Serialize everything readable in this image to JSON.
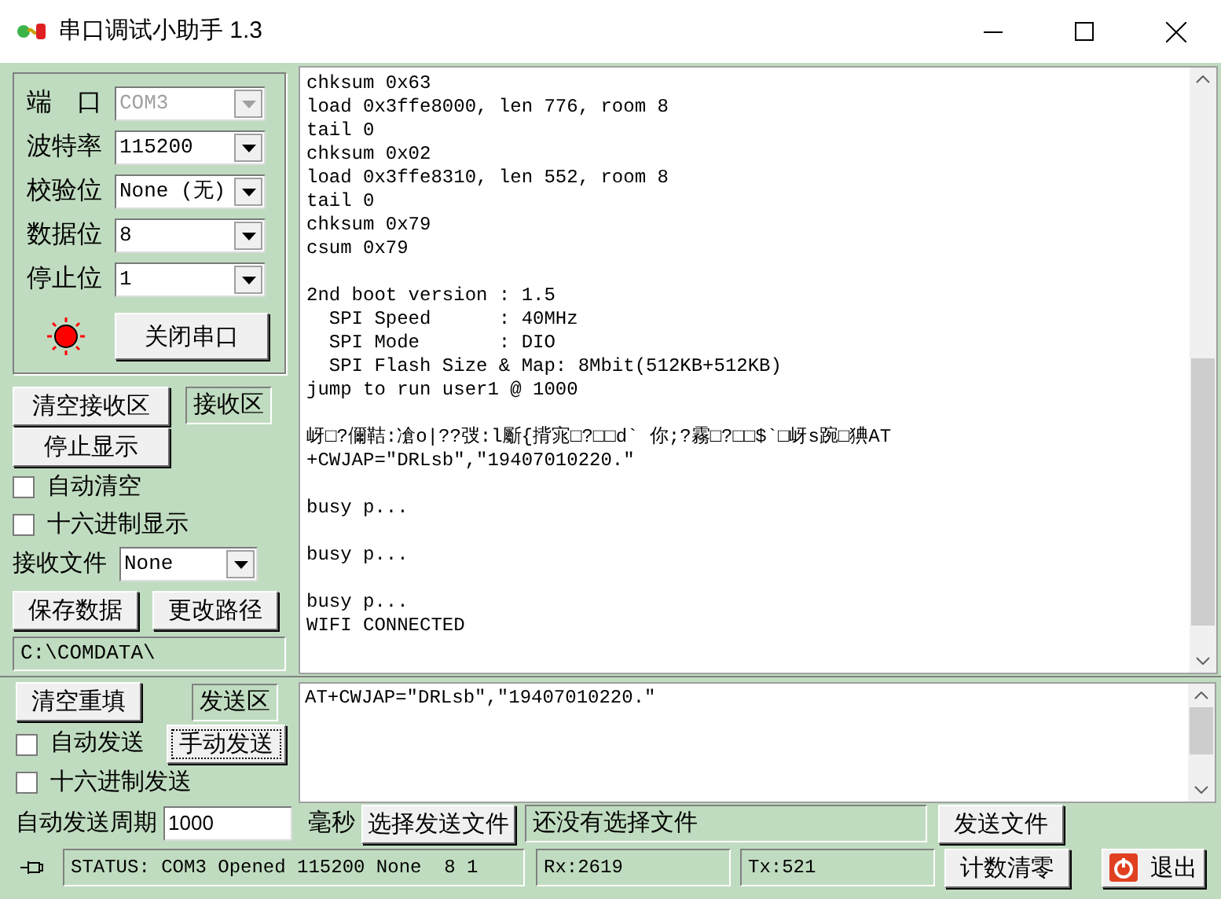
{
  "window": {
    "title": "串口调试小助手 1.3"
  },
  "serial_settings": [
    {
      "label": "端　口",
      "value": "COM3",
      "disabled": true
    },
    {
      "label": "波特率",
      "value": "115200",
      "disabled": false
    },
    {
      "label": "校验位",
      "value": "None (无)",
      "disabled": false
    },
    {
      "label": "数据位",
      "value": "8",
      "disabled": false
    },
    {
      "label": "停止位",
      "value": "1",
      "disabled": false
    }
  ],
  "port_led": {
    "on": true
  },
  "open_button": "关闭串口",
  "receive": {
    "clear_button": "清空接收区",
    "area_label": "接收区",
    "stop_button": "停止显示",
    "checkboxes": [
      {
        "label": "自动清空",
        "checked": false
      },
      {
        "label": "十六进制显示",
        "checked": false
      }
    ],
    "file_label": "接收文件",
    "file_value": "None",
    "save_button": "保存数据",
    "path_button": "更改路径",
    "path": "C:\\COMDATA\\",
    "blocks": [
      [
        "chksum 0x63",
        "load 0x3ffe8000, len 776, room 8",
        "tail 0",
        "chksum 0x02",
        "load 0x3ffe8310, len 552, room 8",
        "tail 0",
        "chksum 0x79",
        "csum 0x79"
      ],
      [
        "2nd boot version : 1.5",
        "  SPI Speed      : 40MHz",
        "  SPI Mode       : DIO",
        "  SPI Flash Size & Map: 8Mbit(512KB+512KB)",
        "jump to run user1 @ 1000"
      ],
      [
        "岈□?儞鞊:凔o|??弢:l斸{揹宨□?□□d` 你;?霧□?□□$`□岈s踠□猠AT",
        "+CWJAP=\"DRLsb\",\"19407010220.\""
      ],
      [
        "busy p..."
      ],
      [
        "busy p..."
      ],
      [
        "busy p...",
        "WIFI CONNECTED"
      ]
    ]
  },
  "send": {
    "clear_button": "清空重填",
    "area_label": "发送区",
    "manual_button": "手动发送",
    "checkboxes": [
      {
        "label": "自动发送",
        "checked": false
      },
      {
        "label": "十六进制发送",
        "checked": false
      }
    ],
    "text": "AT+CWJAP=\"DRLsb\",\"19407010220.\"",
    "period_label": "自动发送周期",
    "period": "1000",
    "unit": "毫秒",
    "choose_file_button": "选择发送文件",
    "file_status": "还没有选择文件",
    "send_file_button": "发送文件"
  },
  "status_bar": {
    "status": "STATUS: COM3 Opened 115200 None  8 1",
    "rx": "Rx:2619",
    "tx": "Tx:521",
    "reset_button": "计数清零",
    "exit_button": "退出"
  }
}
